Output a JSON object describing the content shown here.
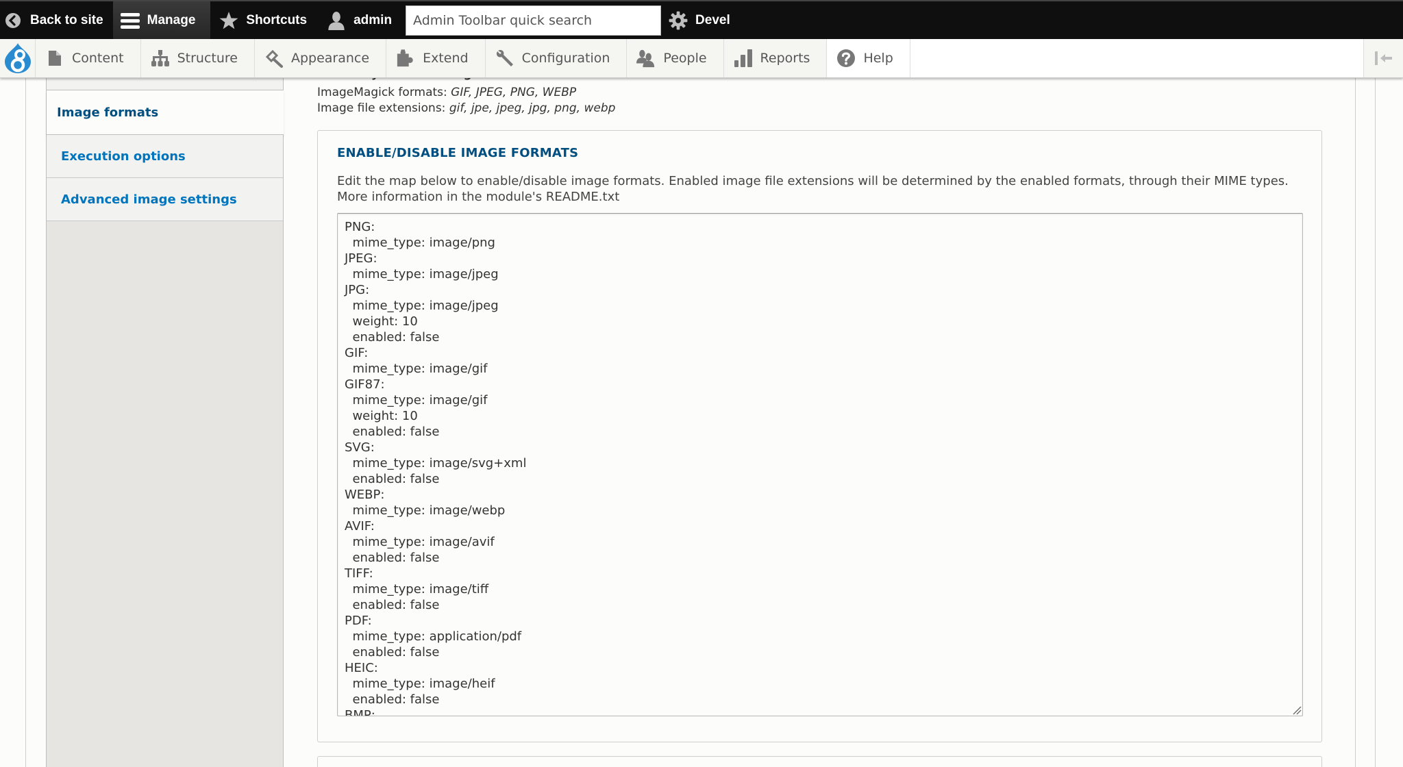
{
  "toolbar": {
    "back_label": "Back to site",
    "manage_label": "Manage",
    "shortcuts_label": "Shortcuts",
    "user_label": "admin",
    "search_placeholder": "Admin Toolbar quick search",
    "devel_label": "Devel"
  },
  "tray": {
    "items": [
      {
        "label": "Content",
        "icon": "file-icon"
      },
      {
        "label": "Structure",
        "icon": "sitemap-icon"
      },
      {
        "label": "Appearance",
        "icon": "paintbrush-icon"
      },
      {
        "label": "Extend",
        "icon": "puzzle-icon"
      },
      {
        "label": "Configuration",
        "icon": "wrench-icon"
      },
      {
        "label": "People",
        "icon": "people-icon"
      },
      {
        "label": "Reports",
        "icon": "bar-chart-icon"
      },
      {
        "label": "Help",
        "icon": "help-icon"
      }
    ]
  },
  "vertical_tabs": {
    "items": [
      {
        "label": "Image formats",
        "selected": true
      },
      {
        "label": "Execution options",
        "selected": false
      },
      {
        "label": "Advanced image settings",
        "selected": false
      }
    ]
  },
  "currently_enabled": {
    "heading": "Currently enabled images",
    "formats_label": "ImageMagick formats: ",
    "formats_value": "GIF, JPEG, PNG, WEBP",
    "extensions_label": "Image file extensions: ",
    "extensions_value": "gif, jpe, jpeg, jpg, png, webp"
  },
  "image_formats_fieldset": {
    "legend": "ENABLE/DISABLE IMAGE FORMATS",
    "description_line1": "Edit the map below to enable/disable image formats. Enabled image file extensions will be determined by the enabled formats, through their MIME types.",
    "description_line2": "More information in the module's README.txt",
    "textarea_value": "PNG:\n  mime_type: image/png\nJPEG:\n  mime_type: image/jpeg\nJPG:\n  mime_type: image/jpeg\n  weight: 10\n  enabled: false\nGIF:\n  mime_type: image/gif\nGIF87:\n  mime_type: image/gif\n  weight: 10\n  enabled: false\nSVG:\n  mime_type: image/svg+xml\n  enabled: false\nWEBP:\n  mime_type: image/webp\nAVIF:\n  mime_type: image/avif\n  enabled: false\nTIFF:\n  mime_type: image/tiff\n  enabled: false\nPDF:\n  mime_type: application/pdf\n  enabled: false\nHEIC:\n  mime_type: image/heif\n  enabled: false\nBMP:"
  },
  "colors": {
    "toolbar_bg": "#0f0f0f",
    "link_blue": "#0074bd",
    "selected_tab_text": "#004f80",
    "drupal_blue": "#2a8cd0"
  }
}
